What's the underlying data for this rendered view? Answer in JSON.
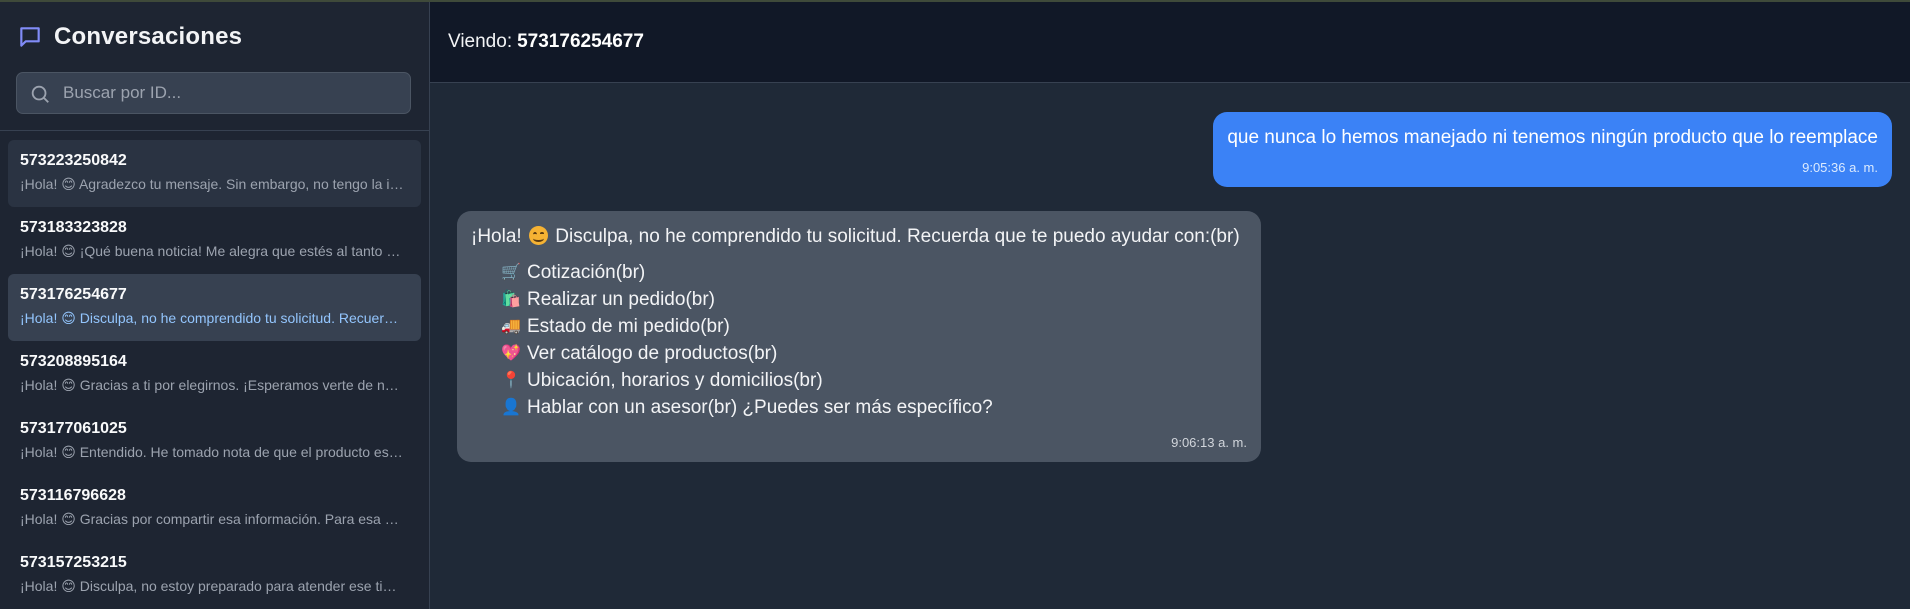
{
  "sidebar": {
    "title": "Conversaciones",
    "title_icon": "chat-bubble-icon",
    "search": {
      "placeholder": "Buscar por ID...",
      "value": ""
    },
    "items": [
      {
        "id": "573223250842",
        "preview": "¡Hola! 😊 Agradezco tu mensaje. Sin embargo, no tengo la información que necesitas en este momento",
        "state": "hover"
      },
      {
        "id": "573183323828",
        "preview": "¡Hola! 😊 ¡Qué buena noticia! Me alegra que estés al tanto de nuestros productos",
        "state": ""
      },
      {
        "id": "573176254677",
        "preview": "¡Hola! 😊 Disculpa, no he comprendido tu solicitud. Recuerda que te puedo ayudar con",
        "state": "active"
      },
      {
        "id": "573208895164",
        "preview": "¡Hola! 😊 Gracias a ti por elegirnos. ¡Esperamos verte de nuevo pronto!",
        "state": ""
      },
      {
        "id": "573177061025",
        "preview": "¡Hola! 😊 Entendido. He tomado nota de que el producto es para uso personal",
        "state": ""
      },
      {
        "id": "573116796628",
        "preview": "¡Hola! 😊 Gracias por compartir esa información. Para esa consulta te recomiendo",
        "state": ""
      },
      {
        "id": "573157253215",
        "preview": "¡Hola! 😊 Disculpa, no estoy preparado para atender ese tipo de solicitud",
        "state": ""
      }
    ]
  },
  "header": {
    "viewing_label": "Viendo:",
    "viewing_id": "573176254677"
  },
  "messages": {
    "outgoing": {
      "text": "que nunca lo hemos manejado ni tenemos ningún producto que lo reemplace",
      "time": "9:05:36 a. m."
    },
    "incoming": {
      "intro_before": "¡Hola!",
      "intro_after": "Disculpa, no he comprendido tu solicitud. Recuerda que te puedo ayudar con:(br)",
      "options": [
        {
          "emoji": "🛒",
          "label": "Cotización(br)"
        },
        {
          "emoji": "🛍️",
          "label": "Realizar un pedido(br)"
        },
        {
          "emoji": "🚚",
          "label": "Estado de mi pedido(br)"
        },
        {
          "emoji": "💖",
          "label": "Ver catálogo de productos(br)"
        },
        {
          "emoji": "📍",
          "label": "Ubicación, horarios y domicilios(br)"
        },
        {
          "emoji": "👤",
          "label": "Hablar con un asesor(br) ¿Puedes ser más específico?"
        }
      ],
      "time": "9:06:13 a. m."
    }
  },
  "colors": {
    "sidebar_bg": "#1e2532",
    "header_bg": "#111827",
    "chat_bg": "#1f2937",
    "outgoing_bubble": "#3b82f6",
    "incoming_bubble": "#4b5563",
    "active_item": "#374151",
    "accent_icon": "#818cf8"
  }
}
